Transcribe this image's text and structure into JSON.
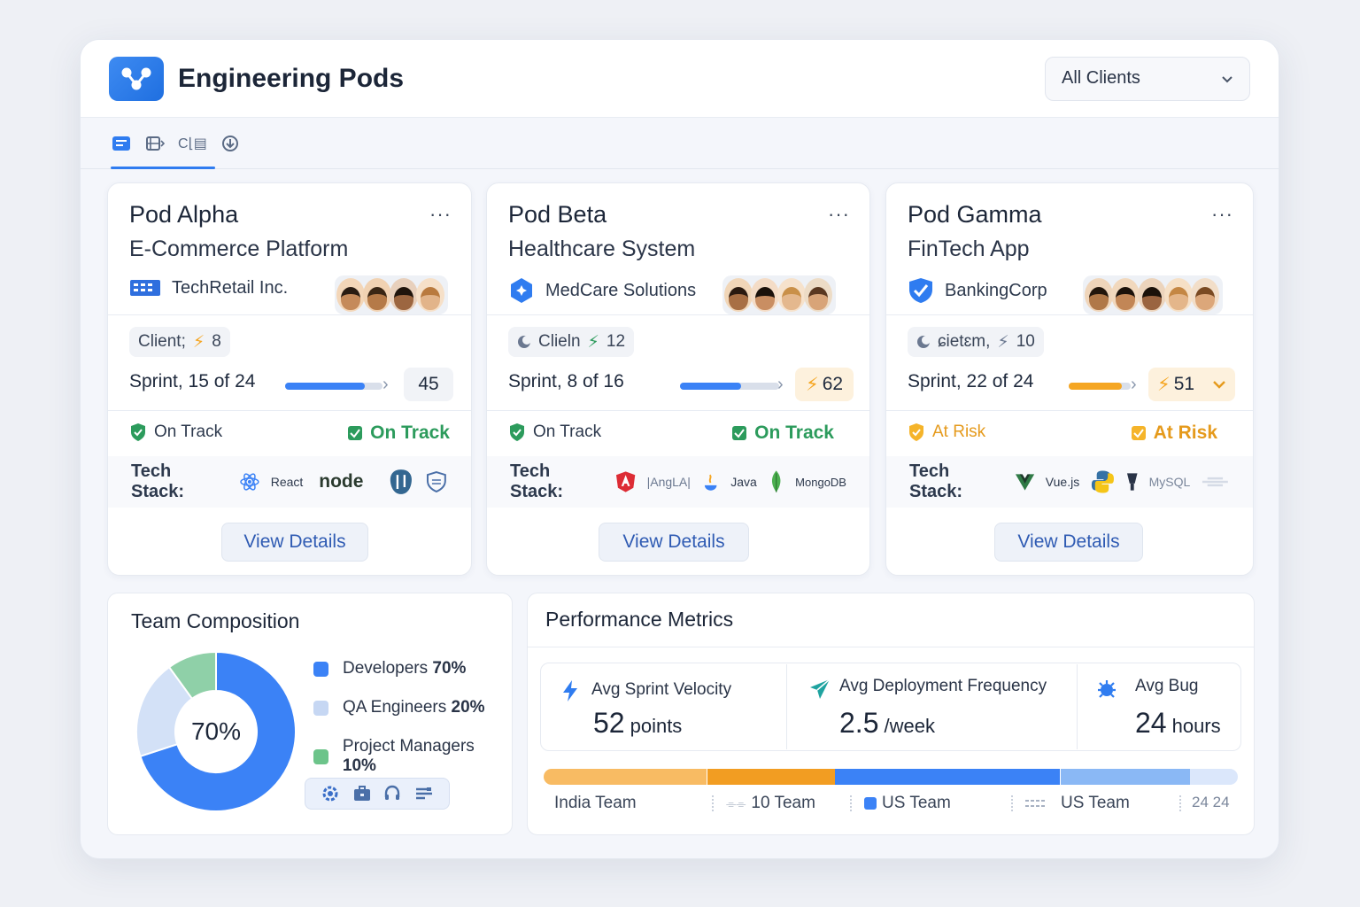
{
  "app": {
    "title": "Engineering Pods",
    "filter_value": "All Clients"
  },
  "toolbar": {
    "label_1": "C⌊▤"
  },
  "pods": [
    {
      "name": "Pod Alpha",
      "project": "E-Commerce Platform",
      "client": "TechRetail Inc.",
      "pill_label": "Client;",
      "pill_value": "8",
      "sprint_label": "Sprint,",
      "sprint_value": "15 of 24",
      "progress": 0.82,
      "bar_color": "#3b82f6",
      "badge_value": "45",
      "status_left": "On Track",
      "status_right": "On Track",
      "status_color": "#2c9b5c",
      "tech_label": "Tech Stack:",
      "tech": [
        "React",
        "node"
      ],
      "action": "View Details"
    },
    {
      "name": "Pod Beta",
      "project": "Healthcare System",
      "client": "MedCare Solutions",
      "pill_label": "Clieln",
      "pill_value": "12",
      "sprint_label": "Sprint,",
      "sprint_value": "8 of 16",
      "progress": 0.62,
      "bar_color": "#3b82f6",
      "badge_value": "62",
      "status_left": "On Track",
      "status_right": "On Track",
      "status_color": "#2c9b5c",
      "tech_label": "Tech Stack:",
      "tech": [
        "|AngLA|",
        "Java",
        "MongoDB"
      ],
      "action": "View Details"
    },
    {
      "name": "Pod Gamma",
      "project": "FinTech App",
      "client": "BankingCorp",
      "pill_label": "ɕietɛm,",
      "pill_value": "10",
      "sprint_label": "Sprint,",
      "sprint_value": "22 of 24",
      "progress": 0.85,
      "bar_color": "#f5a623",
      "badge_value": "51",
      "status_left": "At Risk",
      "status_right": "At Risk",
      "status_color": "#e59a1c",
      "tech_label": "Tech Stack:",
      "tech": [
        "Vue.js",
        "MySQL"
      ],
      "action": "View Details"
    }
  ],
  "team": {
    "title": "Team Composition",
    "center_label": "70%",
    "items": [
      {
        "label": "Developers",
        "value": "70%",
        "color": "#3b82f6"
      },
      {
        "label": "QA Engineers",
        "value": "20%",
        "color": "#c6d7f3"
      },
      {
        "label": "Project Managers",
        "value": "10%",
        "color": "#6cc48a"
      }
    ]
  },
  "performance": {
    "title": "Performance Metrics",
    "metrics": [
      {
        "label": "Avg Sprint Velocity",
        "value": "52",
        "unit": "points"
      },
      {
        "label": "Avg Deployment Frequency",
        "value": "2.5",
        "unit": "/week"
      },
      {
        "label": "Avg Bug",
        "value": "24",
        "unit": "hours"
      }
    ],
    "teams": [
      "India Team",
      "10 Team",
      "US Team",
      "US Team",
      "24 24"
    ]
  }
}
